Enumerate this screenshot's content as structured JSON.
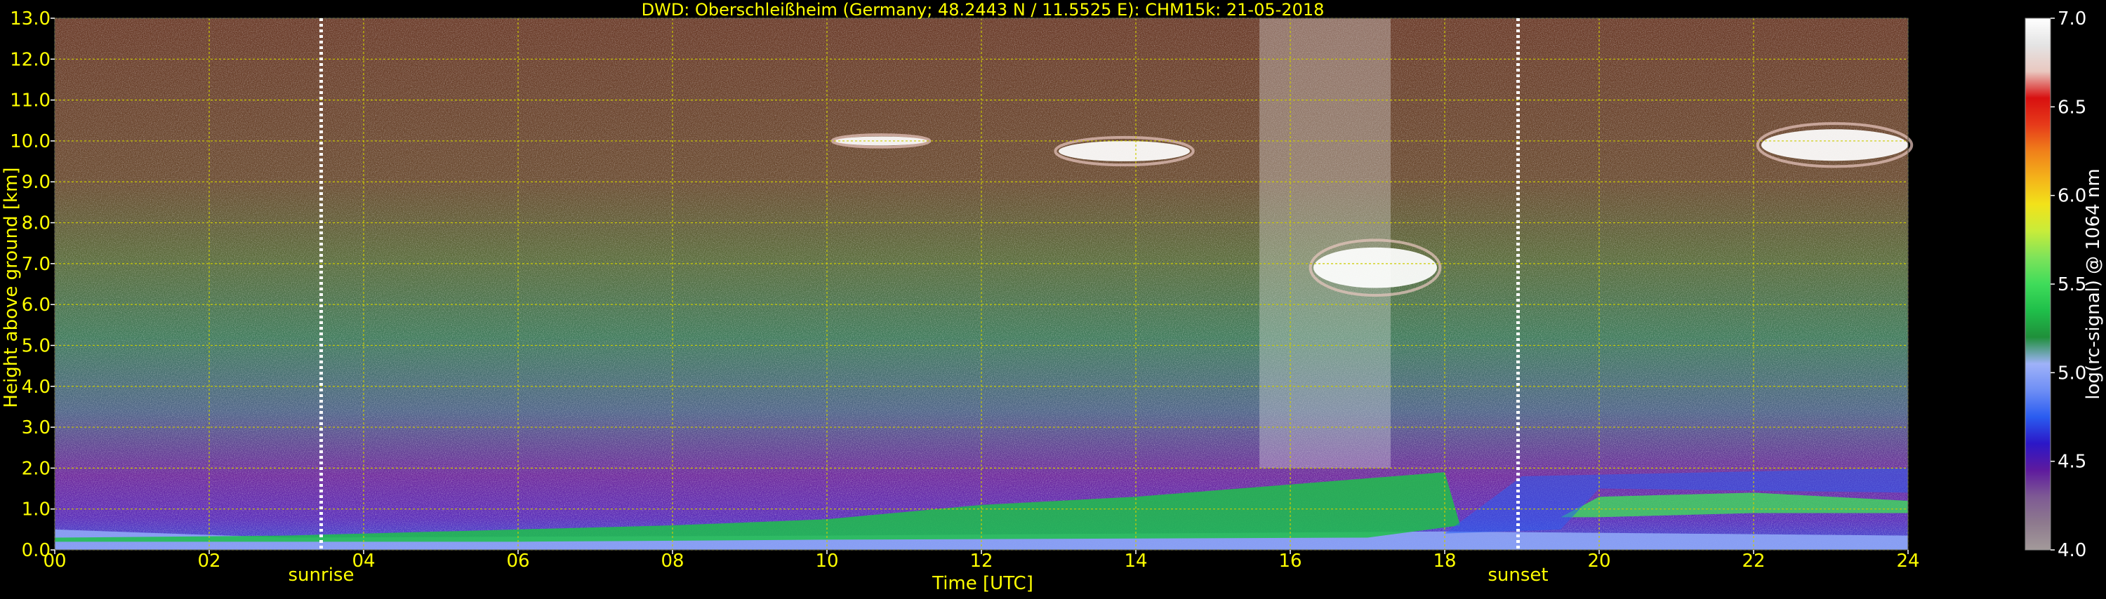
{
  "chart_data": {
    "type": "heatmap",
    "title": "DWD: Oberschleißheim (Germany; 48.2443 N / 11.5525 E):    CHM15k: 21-05-2018",
    "xlabel": "Time [UTC]",
    "ylabel": "Height above ground [km]",
    "colorbar_label": "log(rc-signal) @ 1064 nm",
    "x_unit": "hours UTC",
    "xlim": [
      0,
      24
    ],
    "ylim": [
      0,
      13
    ],
    "x_ticks": [
      "00",
      "02",
      "04",
      "06",
      "08",
      "10",
      "12",
      "14",
      "16",
      "18",
      "20",
      "22",
      "24"
    ],
    "y_ticks": [
      "0.0",
      "1.0",
      "2.0",
      "3.0",
      "4.0",
      "5.0",
      "6.0",
      "7.0",
      "8.0",
      "9.0",
      "10.0",
      "11.0",
      "12.0",
      "13.0"
    ],
    "colorbar_range": [
      4.0,
      7.0
    ],
    "colorbar_ticks": [
      "4.0",
      "4.5",
      "5.0",
      "5.5",
      "6.0",
      "6.5",
      "7.0"
    ],
    "grid": true,
    "annotations": [
      {
        "label": "sunrise",
        "x": 3.45
      },
      {
        "label": "sunset",
        "x": 18.95
      }
    ],
    "colors": {
      "text": "#ffff00",
      "grid": "#cccc00",
      "background": "#000000"
    },
    "colormap": [
      "#a39a9a",
      "#8e7a8e",
      "#7e5a94",
      "#5e1a9e",
      "#2b17c7",
      "#2a5cf0",
      "#6e8ef5",
      "#9fb2f8",
      "#1f8f3a",
      "#1fbf4a",
      "#3fdc5a",
      "#7ee35a",
      "#c8ec3a",
      "#f2e21a",
      "#f4b21a",
      "#f0801a",
      "#e63a1a",
      "#d81010",
      "#e9c8c0",
      "#e4e4e4",
      "#ffffff"
    ],
    "features": [
      {
        "kind": "cirrus",
        "x": [
          13.0,
          14.7
        ],
        "y": [
          9.3,
          10.2
        ]
      },
      {
        "kind": "cirrus",
        "x": [
          10.1,
          11.3
        ],
        "y": [
          9.8,
          10.2
        ]
      },
      {
        "kind": "cirrus",
        "x": [
          16.3,
          17.9
        ],
        "y": [
          6.0,
          7.8
        ]
      },
      {
        "kind": "cirrus",
        "x": [
          22.1,
          24.0
        ],
        "y": [
          9.2,
          10.6
        ]
      },
      {
        "kind": "boundary-layer",
        "x": [
          9.5,
          18.0
        ],
        "y": [
          0.2,
          2.0
        ]
      },
      {
        "kind": "residual-layer",
        "x": [
          19.0,
          24.0
        ],
        "y": [
          0.5,
          2.0
        ]
      }
    ]
  }
}
